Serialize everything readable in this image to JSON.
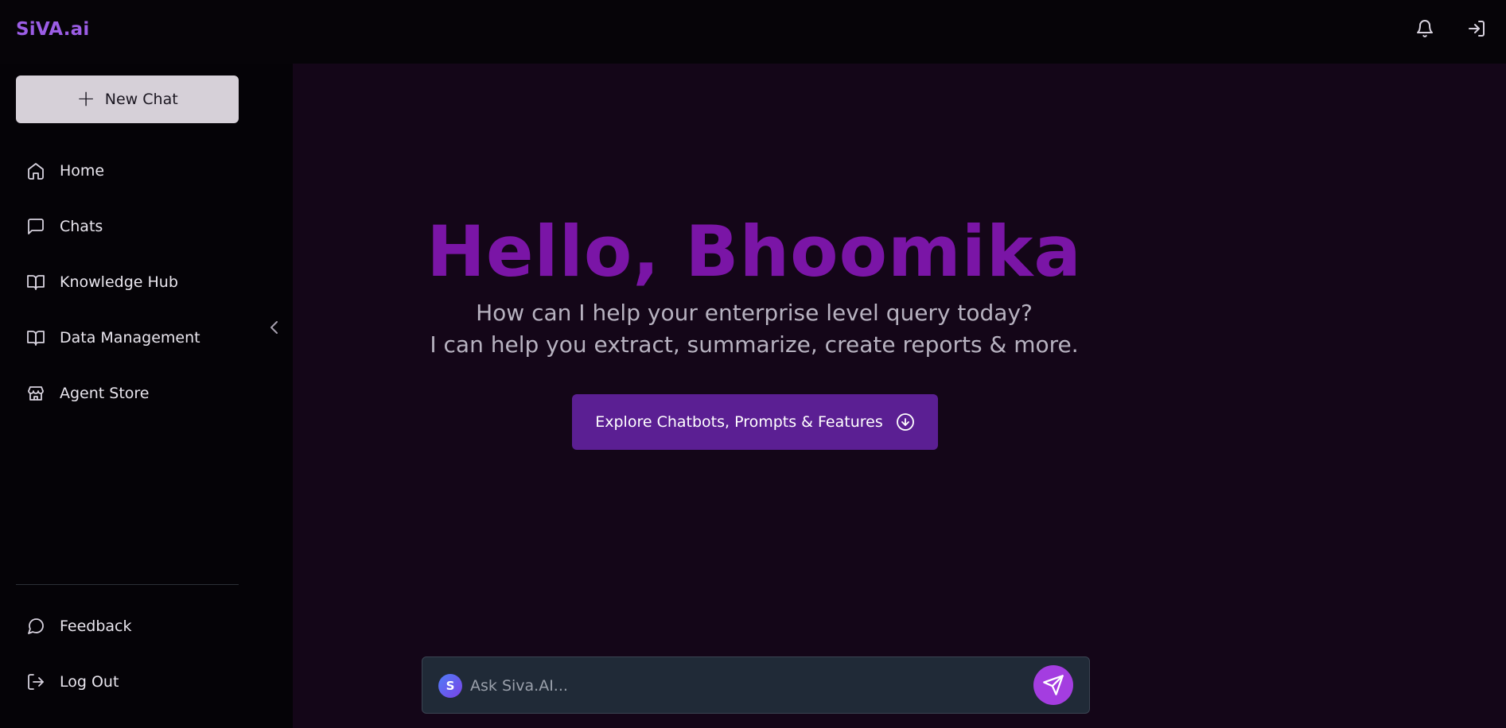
{
  "app": {
    "brand": "SiVA.ai"
  },
  "header": {
    "icons": [
      "bell-icon",
      "log-in-icon"
    ]
  },
  "sidebar": {
    "new_chat_label": "New Chat",
    "items": [
      {
        "label": "Home",
        "icon": "home-icon"
      },
      {
        "label": "Chats",
        "icon": "message-square-icon"
      },
      {
        "label": "Knowledge Hub",
        "icon": "book-open-icon"
      },
      {
        "label": "Data Management",
        "icon": "book-open-icon"
      },
      {
        "label": "Agent Store",
        "icon": "store-icon"
      }
    ],
    "bottom_items": [
      {
        "label": "Feedback",
        "icon": "message-circle-icon"
      },
      {
        "label": "Log Out",
        "icon": "log-out-icon"
      }
    ]
  },
  "main": {
    "greeting": "Hello, Bhoomika",
    "subtitle_line1": "How can I help your enterprise level query today?",
    "subtitle_line2": "I can help you extract, summarize, create reports & more.",
    "explore_label": "Explore Chatbots, Prompts & Features"
  },
  "chat": {
    "avatar_letter": "S",
    "placeholder": "Ask Siva.AI..."
  },
  "colors": {
    "brand": "#9b5de5",
    "greeting": "#7a15a6",
    "button": "#5b1f93",
    "send": "#a43de0",
    "main_bg": "#140618"
  }
}
